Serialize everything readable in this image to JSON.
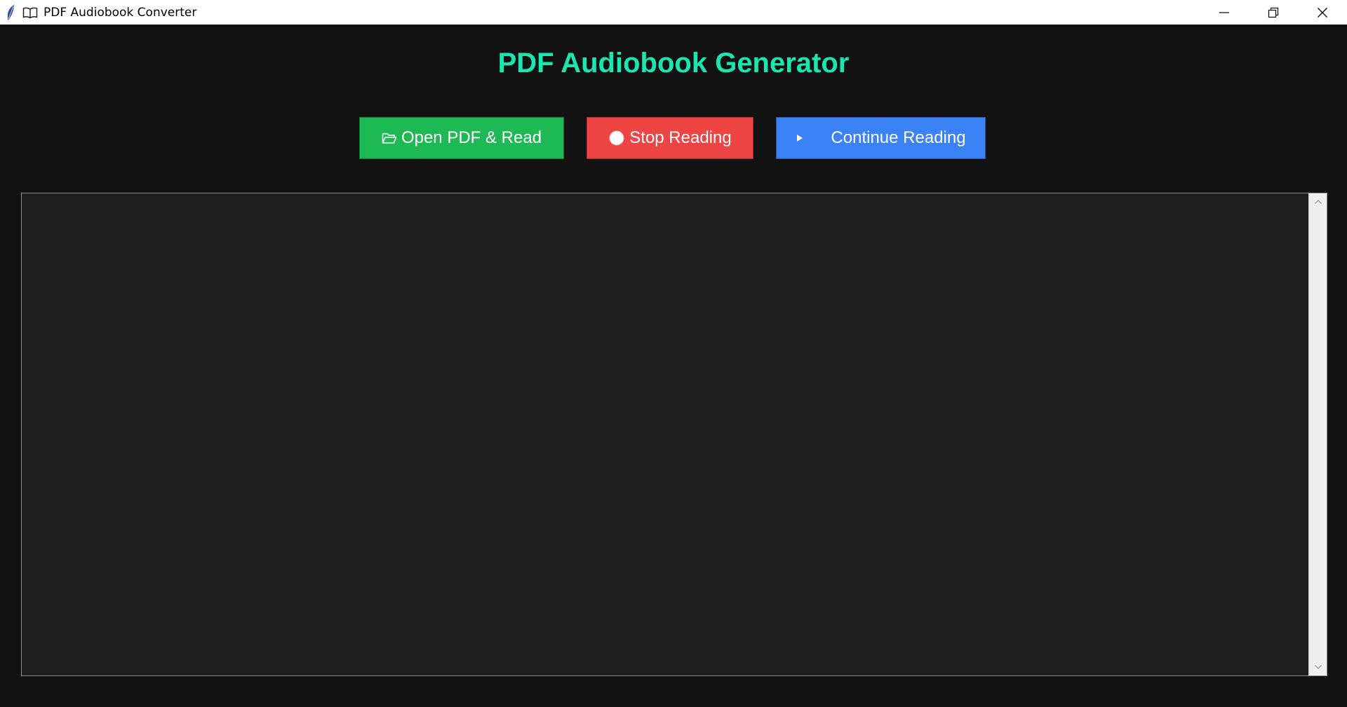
{
  "window": {
    "title": "PDF Audiobook Converter",
    "icons": [
      "feather-icon",
      "book-icon"
    ],
    "controls": [
      "minimize-icon",
      "restore-icon",
      "close-icon"
    ]
  },
  "app": {
    "heading": "PDF Audiobook Generator",
    "heading_color": "#19e6b0",
    "background": "#111111"
  },
  "buttons": {
    "open": {
      "label": "Open PDF & Read",
      "icon": "folder-open-icon",
      "color": "#1db954"
    },
    "stop": {
      "label": "Stop Reading",
      "icon": "stop-circle-icon",
      "color": "#ef4444"
    },
    "continue": {
      "label": "Continue Reading",
      "icon": "play-icon",
      "color": "#3b82f6"
    }
  },
  "text_area": {
    "content": "",
    "background": "#1e1e1e"
  }
}
